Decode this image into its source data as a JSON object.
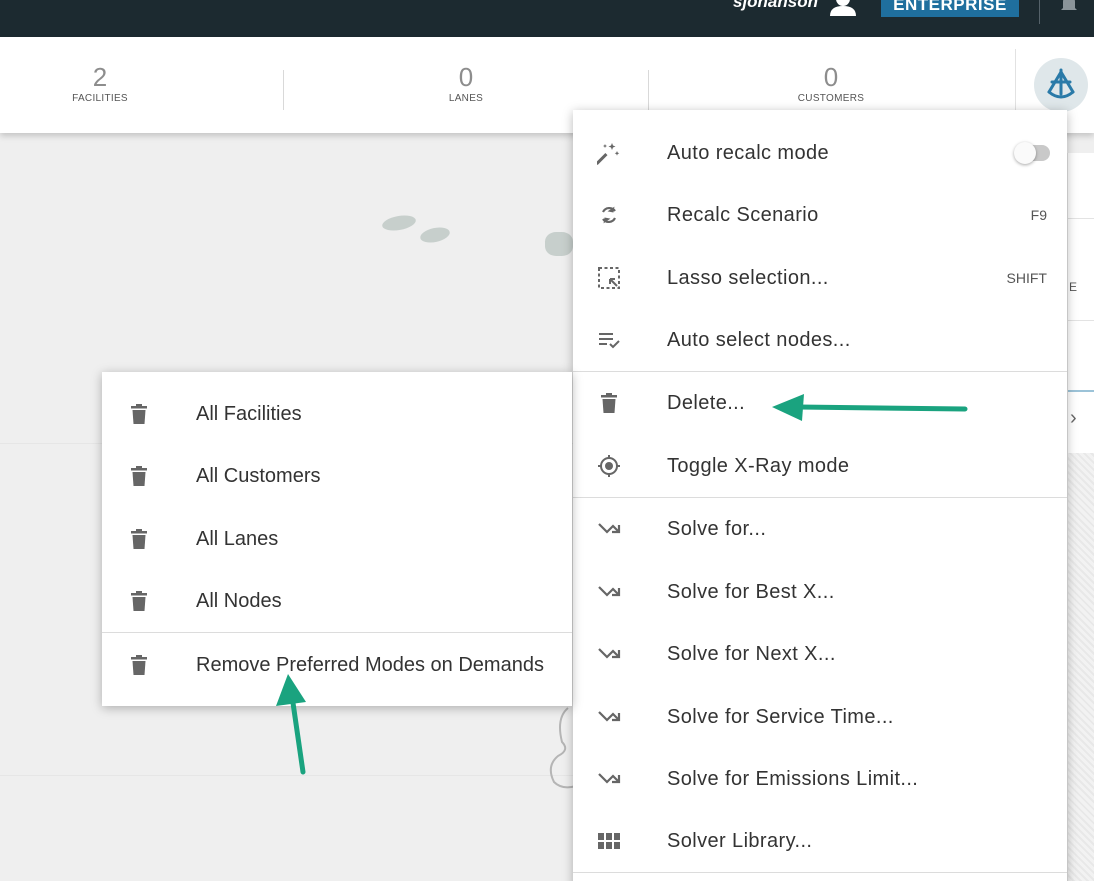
{
  "topbar": {
    "username": "sjohanson",
    "edition_badge": "ENTERPRISE"
  },
  "stats": [
    {
      "value": "2",
      "label": "FACILITIES"
    },
    {
      "value": "0",
      "label": "LANES"
    },
    {
      "value": "0",
      "label": "CUSTOMERS"
    }
  ],
  "main_menu": {
    "items": [
      {
        "label": "Auto recalc mode",
        "icon": "magic-wand-icon",
        "toggle": "off"
      },
      {
        "label": "Recalc Scenario",
        "icon": "refresh-icon",
        "shortcut": "F9"
      },
      {
        "label": "Lasso selection...",
        "icon": "lasso-select-icon",
        "shortcut": "SHIFT"
      },
      {
        "label": "Auto select nodes...",
        "icon": "playlist-check-icon"
      },
      {
        "label": "Delete...",
        "icon": "trash-icon"
      },
      {
        "label": "Toggle X-Ray mode",
        "icon": "target-icon"
      },
      {
        "label": "Solve for...",
        "icon": "trend-arrow-icon"
      },
      {
        "label": "Solve for Best X...",
        "icon": "trend-arrow-icon"
      },
      {
        "label": "Solve for Next X...",
        "icon": "trend-arrow-icon"
      },
      {
        "label": "Solve for Service Time...",
        "icon": "trend-arrow-icon"
      },
      {
        "label": "Solve for Emissions Limit...",
        "icon": "trend-arrow-icon"
      },
      {
        "label": "Solver Library...",
        "icon": "grid-icon"
      }
    ]
  },
  "delete_submenu": {
    "items": [
      {
        "label": "All Facilities",
        "icon": "trash-icon"
      },
      {
        "label": "All Customers",
        "icon": "trash-icon"
      },
      {
        "label": "All Lanes",
        "icon": "trash-icon"
      },
      {
        "label": "All Nodes",
        "icon": "trash-icon"
      },
      {
        "label": "Remove Preferred Modes on Demands",
        "icon": "trash-icon"
      }
    ]
  },
  "colors": {
    "topbar": "#1c2a30",
    "badge": "#1f6f9e",
    "annotation_arrow": "#1aa37f",
    "icon": "#666666"
  }
}
